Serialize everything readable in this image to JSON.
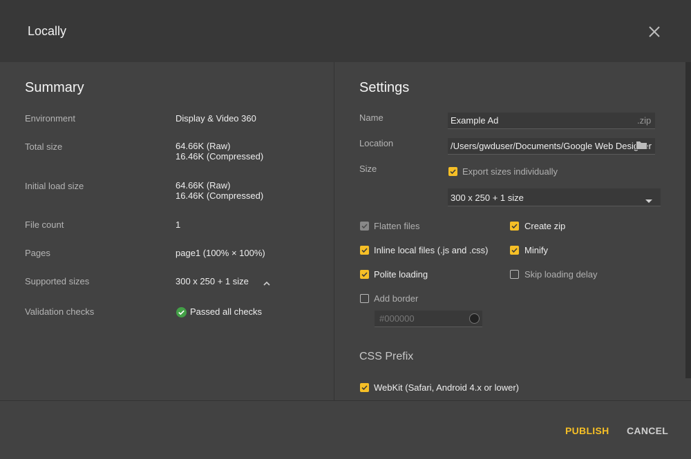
{
  "dialog": {
    "title": "Locally"
  },
  "summary": {
    "title": "Summary",
    "rows": [
      {
        "label": "Environment",
        "value": "Display & Video 360"
      },
      {
        "label": "Total size",
        "value": "64.66K (Raw)",
        "value2": "16.46K (Compressed)"
      },
      {
        "label": "Initial load size",
        "value": "64.66K (Raw)",
        "value2": "16.46K (Compressed)"
      },
      {
        "label": "File count",
        "value": "1"
      },
      {
        "label": "Pages",
        "value": "page1 (100% × 100%)"
      },
      {
        "label": "Supported sizes",
        "value": "300 x 250 + 1 size"
      },
      {
        "label": "Validation checks",
        "value": "Passed all checks"
      }
    ]
  },
  "settings": {
    "title": "Settings",
    "name_label": "Name",
    "name_value": "Example Ad",
    "name_suffix": ".zip",
    "location_label": "Location",
    "location_value": "/Users/gwduser/Documents/Google Web Designer",
    "size_label": "Size",
    "export_sizes_label": "Export sizes individually",
    "size_select_value": "300 x 250 + 1 size",
    "options": {
      "flatten_files": "Flatten files",
      "create_zip": "Create zip",
      "inline_local_files": "Inline local files (.js and .css)",
      "minify": "Minify",
      "polite_loading": "Polite loading",
      "skip_loading_delay": "Skip loading delay",
      "add_border": "Add border"
    },
    "border_color_placeholder": "#000000",
    "css_prefix_title": "CSS Prefix",
    "webkit_label": "WebKit (Safari, Android 4.x or lower)"
  },
  "footer": {
    "publish_label": "PUBLISH",
    "cancel_label": "CANCEL"
  },
  "colors": {
    "accent": "#f6bf26",
    "success": "#43a047"
  }
}
